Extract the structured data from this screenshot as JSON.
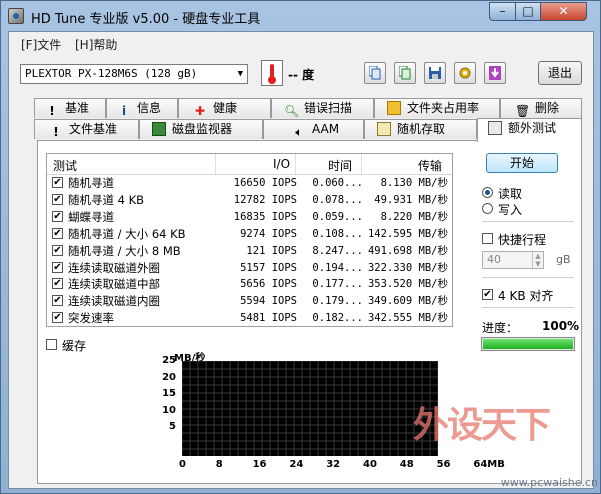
{
  "window": {
    "title": "HD Tune 专业版 v5.00 - 硬盘专业工具",
    "controls": {
      "minimize": "–",
      "maximize": "□",
      "close": "✕"
    }
  },
  "menu": {
    "file": "[F]文件",
    "help": "[H]帮助"
  },
  "toolbar": {
    "drive": "PLEXTOR PX-128M6S (128 gB)",
    "temperature": "-- 度",
    "exit_label": "退出",
    "icons": [
      "copy-icon",
      "copy-all-icon",
      "save-icon",
      "options-icon",
      "download-icon"
    ]
  },
  "tabs_top": [
    {
      "label": "基准",
      "icon": "exclamation-icon"
    },
    {
      "label": "信息",
      "icon": "info-icon"
    },
    {
      "label": "健康",
      "icon": "health-cross-icon"
    },
    {
      "label": "错误扫描",
      "icon": "magnifier-icon"
    },
    {
      "label": "文件夹占用率",
      "icon": "folder-icon"
    },
    {
      "label": "删除",
      "icon": "trash-icon"
    }
  ],
  "tabs_bottom": [
    {
      "label": "文件基准",
      "icon": "exclamation-icon"
    },
    {
      "label": "磁盘监视器",
      "icon": "monitor-icon"
    },
    {
      "label": "AAM",
      "icon": "speaker-icon"
    },
    {
      "label": "随机存取",
      "icon": "dice-icon"
    },
    {
      "label": "额外测试",
      "icon": "clipboard-icon",
      "active": true
    }
  ],
  "table": {
    "headers": {
      "test": "测试",
      "io": "I/O",
      "time": "时间",
      "transfer": "传输"
    },
    "rows": [
      {
        "name": "随机寻道",
        "iops": "16650 IOPS",
        "time": "0.060...",
        "transfer": "8.130 MB/秒"
      },
      {
        "name": "随机寻道 4 KB",
        "iops": "12782 IOPS",
        "time": "0.078...",
        "transfer": "49.931 MB/秒"
      },
      {
        "name": "蝴蝶寻道",
        "iops": "16835 IOPS",
        "time": "0.059...",
        "transfer": "8.220 MB/秒"
      },
      {
        "name": "随机寻道 / 大小 64 KB",
        "iops": "9274 IOPS",
        "time": "0.108...",
        "transfer": "142.595 MB/秒"
      },
      {
        "name": "随机寻道 / 大小 8 MB",
        "iops": "121 IOPS",
        "time": "8.247...",
        "transfer": "491.698 MB/秒"
      },
      {
        "name": "连续读取磁道外圈",
        "iops": "5157 IOPS",
        "time": "0.194...",
        "transfer": "322.330 MB/秒"
      },
      {
        "name": "连续读取磁道中部",
        "iops": "5656 IOPS",
        "time": "0.177...",
        "transfer": "353.520 MB/秒"
      },
      {
        "name": "连续读取磁道内圈",
        "iops": "5594 IOPS",
        "time": "0.179...",
        "transfer": "349.609 MB/秒"
      },
      {
        "name": "突发速率",
        "iops": "5481 IOPS",
        "time": "0.182...",
        "transfer": "342.555 MB/秒"
      }
    ]
  },
  "cache_label": "缓存",
  "side": {
    "start_label": "开始",
    "read_label": "读取",
    "write_label": "写入",
    "quick_label": "快捷行程",
    "quick_value": "40",
    "quick_unit": "gB",
    "align_label": "4 KB 对齐",
    "progress_label": "进度：",
    "progress_value": "100%",
    "progress_fraction": 1.0
  },
  "graph": {
    "unit": "MB/秒",
    "yticks": [
      "25",
      "20",
      "15",
      "10",
      "5"
    ],
    "xticks": [
      "0",
      "8",
      "16",
      "24",
      "32",
      "40",
      "48",
      "56",
      "64MB"
    ]
  },
  "watermark": {
    "brand": "外设天下",
    "url": "www.pcwaishe.cn"
  }
}
